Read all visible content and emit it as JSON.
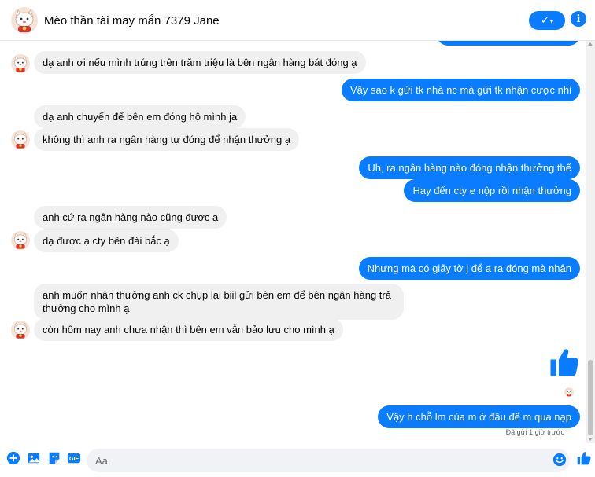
{
  "header": {
    "title": "Mèo thần tài may mắn 7379 Jane",
    "check_label": "✓",
    "check_caret": "▾",
    "info_label": "i"
  },
  "messages": [
    {
      "dir": "in",
      "text": "dạ anh ơi nếu mình trúng trên trăm triệu là bên ngân hàng bát đóng ạ"
    },
    {
      "dir": "out",
      "text": "Vậy sao k gửi tk nhà nc mà gửi tk nhận cược nhỉ"
    },
    {
      "dir": "in",
      "text": "dạ anh chuyển để bên em đóng hộ mình ja"
    },
    {
      "dir": "in",
      "text": "không thì anh ra ngân hàng tự đóng để nhận thưởng ạ"
    },
    {
      "dir": "out",
      "text": "Uh, ra ngân hàng nào đóng nhận thưởng thế"
    },
    {
      "dir": "out",
      "text": "Hay đến cty e nộp rồi nhận thưởng"
    },
    {
      "dir": "in",
      "text": "anh cứ ra ngân hàng nào cũng được ạ"
    },
    {
      "dir": "in",
      "text": "dạ được ạ cty bên đài bắc ạ"
    },
    {
      "dir": "out",
      "text": "Nhưng mà có giấy tờ j để a ra đóng mà nhận"
    },
    {
      "dir": "in",
      "text": "anh muốn nhận thưởng anh ck chụp lại biil gửi bên em để bên ngân hàng trả thưởng cho mình ạ"
    },
    {
      "dir": "in",
      "text": "còn hôm nay anh chưa nhận thì bên em vẫn bảo lưu cho mình ạ"
    },
    {
      "dir": "out",
      "text": "Vậy h chỗ lm của m ở đâu để m qua nạp"
    }
  ],
  "status": "Đã gửi 1 giờ trước",
  "composer": {
    "placeholder": "Aa",
    "icons": [
      "plus-icon",
      "image-icon",
      "sticker-icon",
      "gif-icon",
      "emoji-icon",
      "thumbs-up-icon"
    ]
  },
  "colors": {
    "accent": "#0a7cff",
    "incoming_bubble": "#f0f0f0",
    "text": "#050505",
    "muted": "#65676b"
  }
}
